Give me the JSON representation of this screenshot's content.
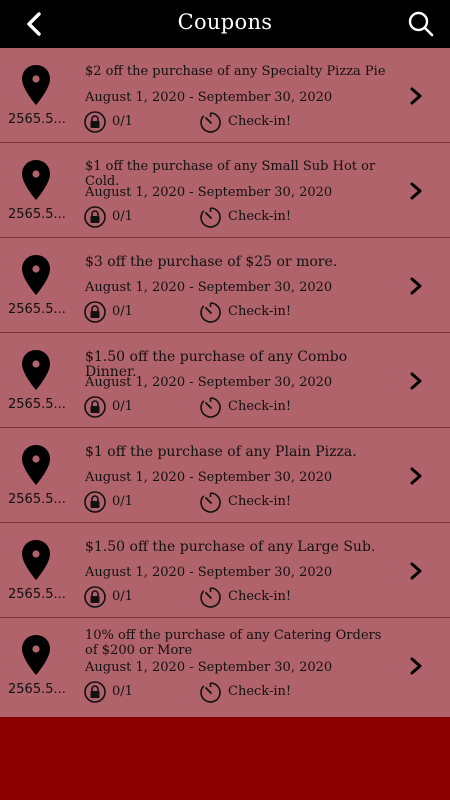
{
  "header": {
    "title": "Coupons",
    "back_icon": "chevron-left-icon",
    "search_icon": "search-icon"
  },
  "colors": {
    "topbar": "#000000",
    "row_background": "#b1636b",
    "row_divider": "#7d2f37",
    "footer": "#8b0000"
  },
  "coupons": [
    {
      "distance": "2565.5...",
      "offer": "$2 off the purchase of any Specialty Pizza Pie",
      "dates": "August 1, 2020 - September 30, 2020",
      "count": "0/1",
      "action": "Check-in!"
    },
    {
      "distance": "2565.5...",
      "offer": "$1 off the purchase of any Small Sub Hot or Cold.",
      "dates": "August 1, 2020 - September 30, 2020",
      "count": "0/1",
      "action": "Check-in!"
    },
    {
      "distance": "2565.5...",
      "offer": "$3 off the purchase of $25 or more.",
      "dates": "August 1, 2020 - September 30, 2020",
      "count": "0/1",
      "action": "Check-in!"
    },
    {
      "distance": "2565.5...",
      "offer": "$1.50 off the purchase of any Combo Dinner.",
      "dates": "August 1, 2020 - September 30, 2020",
      "count": "0/1",
      "action": "Check-in!"
    },
    {
      "distance": "2565.5...",
      "offer": "$1 off the purchase of any Plain Pizza.",
      "dates": "August 1, 2020 - September 30, 2020",
      "count": "0/1",
      "action": "Check-in!"
    },
    {
      "distance": "2565.5...",
      "offer": "$1.50 off the purchase of any Large Sub.",
      "dates": "August 1, 2020 - September 30, 2020",
      "count": "0/1",
      "action": "Check-in!"
    },
    {
      "distance": "2565.5...",
      "offer": "10% off the purchase of any Catering Orders of $200 or More",
      "dates": "August 1, 2020 - September 30, 2020",
      "count": "0/1",
      "action": "Check-in!"
    }
  ]
}
